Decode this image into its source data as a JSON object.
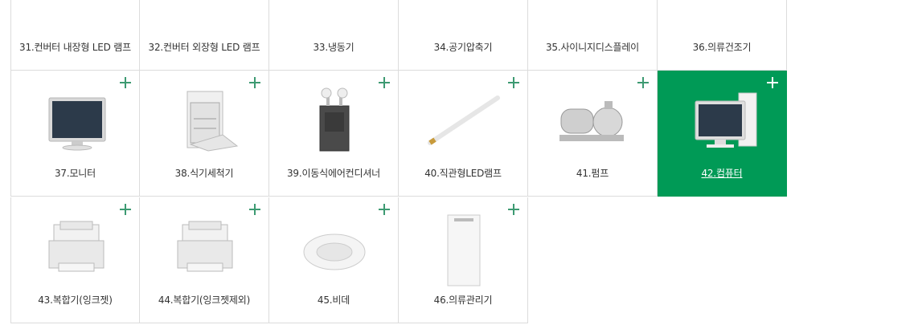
{
  "colors": {
    "accent": "#009a56",
    "plus": "#3d9a72",
    "border": "#dcdcdc"
  },
  "row1": [
    {
      "label": "31.컨버터 내장형 LED 램프",
      "icon": "led-bulb-icon"
    },
    {
      "label": "32.컨버터 외장형 LED 램프",
      "icon": "led-tube-icon"
    },
    {
      "label": "33.냉동기",
      "icon": "refrigerator-unit-icon"
    },
    {
      "label": "34.공기압축기",
      "icon": "air-compressor-icon"
    },
    {
      "label": "35.사이니지디스플레이",
      "icon": "signage-display-icon"
    },
    {
      "label": "36.의류건조기",
      "icon": "clothes-dryer-icon"
    }
  ],
  "row2": [
    {
      "label": "37.모니터",
      "icon": "monitor-icon"
    },
    {
      "label": "38.식기세척기",
      "icon": "dishwasher-icon"
    },
    {
      "label": "39.이동식에어컨디셔너",
      "icon": "portable-ac-icon"
    },
    {
      "label": "40.직관형LED램프",
      "icon": "led-tube-icon"
    },
    {
      "label": "41.펌프",
      "icon": "pump-icon"
    },
    {
      "label": "42.컴퓨터",
      "icon": "computer-icon",
      "active": true
    }
  ],
  "row3": [
    {
      "label": "43.복합기(잉크젯)",
      "icon": "printer-icon"
    },
    {
      "label": "44.복합기(잉크젯제외)",
      "icon": "printer-icon"
    },
    {
      "label": "45.비데",
      "icon": "bidet-icon"
    },
    {
      "label": "46.의류관리기",
      "icon": "clothes-care-icon"
    }
  ]
}
